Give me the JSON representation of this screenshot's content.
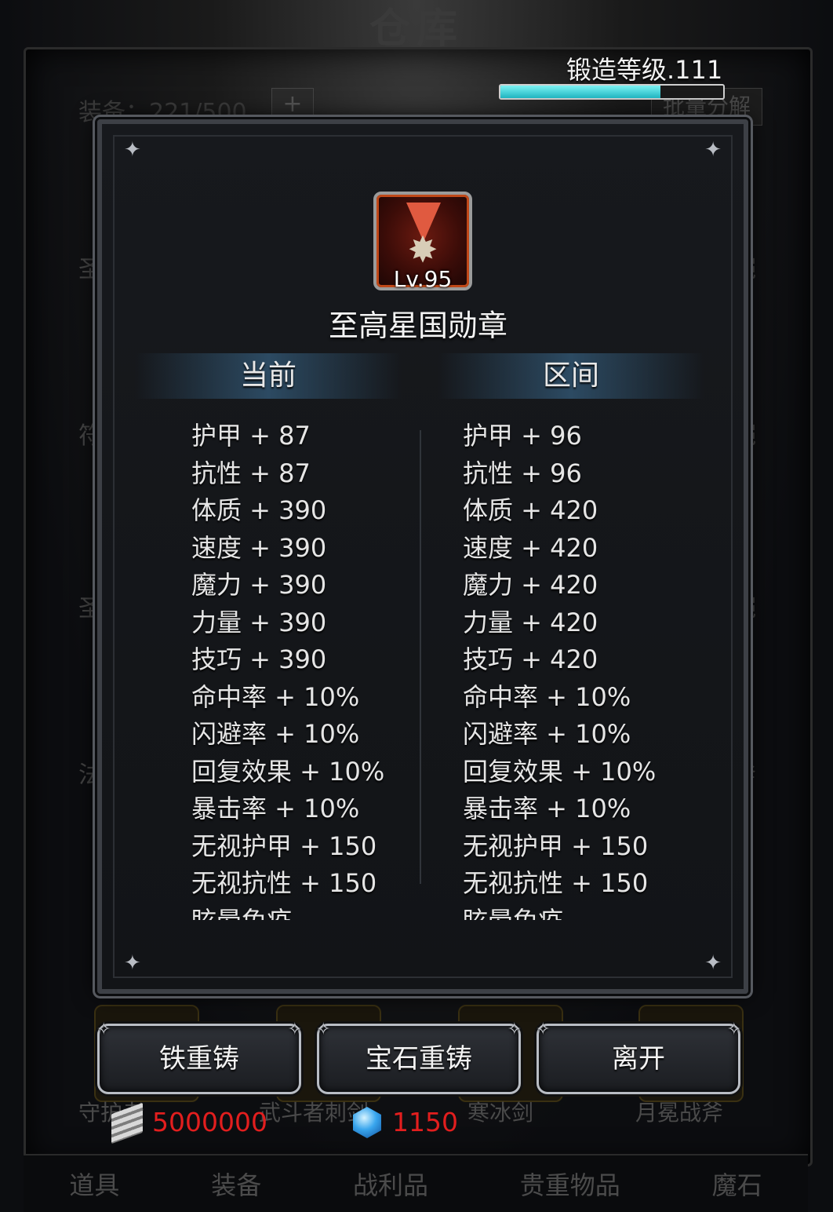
{
  "background": {
    "title": "仓库",
    "capacity": "装备：221/500",
    "plus": "+",
    "batch_label": "批量分解",
    "side_left": [
      "圣",
      "符",
      "圣",
      "法"
    ],
    "side_right": [
      "铠",
      "铠",
      "铠",
      "斧"
    ],
    "bottom_items": [
      "守护者",
      "武斗者刺剑",
      "寒冰剑",
      "月冕战斧"
    ],
    "tabs": [
      "道具",
      "装备",
      "战利品",
      "贵重物品",
      "魔石"
    ]
  },
  "forge": {
    "label": "锻造等级.111",
    "progress": 0.72
  },
  "item": {
    "icon": "medal-icon",
    "level": "Lv.95",
    "name": "至高星国勋章"
  },
  "columns": {
    "current": "当前",
    "range": "区间"
  },
  "current_stats": [
    "护甲 + 87",
    "抗性 + 87",
    "体质 + 390",
    "速度 + 390",
    "魔力 + 390",
    "力量 + 390",
    "技巧 + 390",
    "命中率 + 10%",
    "闪避率 + 10%",
    "回复效果 + 10%",
    "暴击率 + 10%",
    "无视护甲 + 150",
    "无视抗性 + 150",
    "眩晕免疫"
  ],
  "range_stats": [
    "护甲 + 96",
    "抗性 + 96",
    "体质 + 420",
    "速度 + 420",
    "魔力 + 420",
    "力量 + 420",
    "技巧 + 420",
    "命中率 + 10%",
    "闪避率 + 10%",
    "回复效果 + 10%",
    "暴击率 + 10%",
    "无视护甲 + 150",
    "无视抗性 + 150",
    "眩晕免疫"
  ],
  "buttons": {
    "iron_reforge": "铁重铸",
    "gem_reforge": "宝石重铸",
    "leave": "离开"
  },
  "currency": {
    "iron": "5000000",
    "gem": "1150",
    "color": "#e21e1e"
  }
}
